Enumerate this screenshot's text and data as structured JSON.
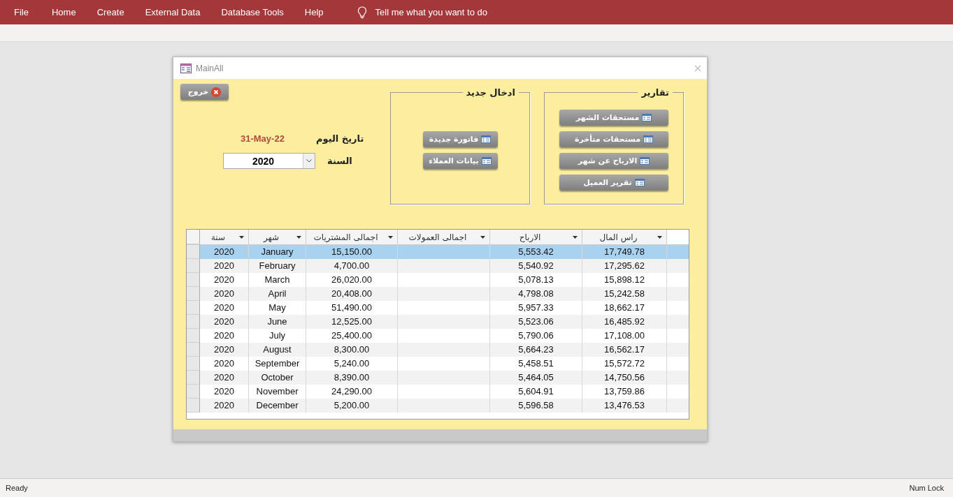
{
  "ribbon": {
    "tabs": [
      "File",
      "Home",
      "Create",
      "External Data",
      "Database Tools",
      "Help"
    ],
    "tell_me": "Tell me what you want to do"
  },
  "window": {
    "title": "MainAll"
  },
  "form": {
    "exit_button": "خروج",
    "date_label": "تاريخ اليوم",
    "date_value": "31-May-22",
    "year_label": "السنة",
    "year_value": "2020",
    "new_entry": {
      "title": "ادخال جديد",
      "buttons": [
        "فاتورة جديدة",
        "بيانات العملاء"
      ]
    },
    "reports": {
      "title": "تقارير",
      "buttons": [
        "مستحقات الشهر",
        "مستحقات متأخرة",
        "الارباح عن شهر",
        "تقرير العميل"
      ]
    }
  },
  "table": {
    "columns": [
      "سنة",
      "شهر",
      "اجمالى المشتريات",
      "اجمالى العمولات",
      "الارباح",
      "راس المال"
    ],
    "rows": [
      {
        "cells": [
          "2020",
          "January",
          "15,150.00",
          "",
          "5,553.42",
          "17,749.78"
        ],
        "selected": true
      },
      {
        "cells": [
          "2020",
          "February",
          "4,700.00",
          "",
          "5,540.92",
          "17,295.62"
        ],
        "selected": false
      },
      {
        "cells": [
          "2020",
          "March",
          "26,020.00",
          "",
          "5,078.13",
          "15,898.12"
        ],
        "selected": false
      },
      {
        "cells": [
          "2020",
          "April",
          "20,408.00",
          "",
          "4,798.08",
          "15,242.58"
        ],
        "selected": false
      },
      {
        "cells": [
          "2020",
          "May",
          "51,490.00",
          "",
          "5,957.33",
          "18,662.17"
        ],
        "selected": false
      },
      {
        "cells": [
          "2020",
          "June",
          "12,525.00",
          "",
          "5,523.06",
          "16,485.92"
        ],
        "selected": false
      },
      {
        "cells": [
          "2020",
          "July",
          "25,400.00",
          "",
          "5,790.06",
          "17,108.00"
        ],
        "selected": false
      },
      {
        "cells": [
          "2020",
          "August",
          "8,300.00",
          "",
          "5,664.23",
          "16,562.17"
        ],
        "selected": false
      },
      {
        "cells": [
          "2020",
          "September",
          "5,240.00",
          "",
          "5,458.51",
          "15,572.72"
        ],
        "selected": false
      },
      {
        "cells": [
          "2020",
          "October",
          "8,390.00",
          "",
          "5,464.05",
          "14,750.56"
        ],
        "selected": false
      },
      {
        "cells": [
          "2020",
          "November",
          "24,290.00",
          "",
          "5,604.91",
          "13,759.86"
        ],
        "selected": false
      },
      {
        "cells": [
          "2020",
          "December",
          "5,200.00",
          "",
          "5,596.58",
          "13,476.53"
        ],
        "selected": false
      }
    ]
  },
  "status_bar": {
    "left": "Ready",
    "right": "Num Lock"
  }
}
